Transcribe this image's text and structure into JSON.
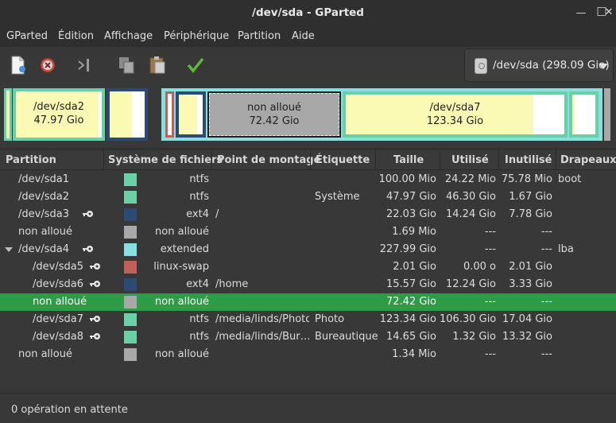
{
  "window": {
    "title": "/dev/sda - GParted"
  },
  "menu": [
    "GParted",
    "Édition",
    "Affichage",
    "Périphérique",
    "Partition",
    "Aide"
  ],
  "toolbar": {
    "buttons": [
      "new-icon",
      "delete-icon",
      "resize-move-icon",
      "copy-icon",
      "paste-icon",
      "apply-icon"
    ],
    "device": "/dev/sda (298.09 Gio)"
  },
  "diskmap": {
    "sda2": {
      "name": "/dev/sda2",
      "size": "47.97 Gio"
    },
    "unalloc": {
      "name": "non alloué",
      "size": "72.42 Gio"
    },
    "sda7": {
      "name": "/dev/sda7",
      "size": "123.34 Gio"
    }
  },
  "columns": [
    "Partition",
    "Système de fichiers",
    "Point de montage",
    "Étiquette",
    "Taille",
    "Utilisé",
    "Inutilisé",
    "Drapeaux"
  ],
  "rows": [
    {
      "partition": "/dev/sda1",
      "fs": "ntfs",
      "mount": "",
      "label": "",
      "size": "100.00 Mio",
      "used": "24.22 Mio",
      "unused": "75.78 Mio",
      "flags": "boot",
      "color": "#6bd0a8",
      "locked": false,
      "indent": 1,
      "expander": false,
      "selected": false
    },
    {
      "partition": "/dev/sda2",
      "fs": "ntfs",
      "mount": "",
      "label": "Système",
      "size": "47.97 Gio",
      "used": "46.30 Gio",
      "unused": "1.67 Gio",
      "flags": "",
      "color": "#6bd0a8",
      "locked": false,
      "indent": 1,
      "expander": false,
      "selected": false
    },
    {
      "partition": "/dev/sda3",
      "fs": "ext4",
      "mount": "/",
      "label": "",
      "size": "22.03 Gio",
      "used": "14.24 Gio",
      "unused": "7.78 Gio",
      "flags": "",
      "color": "#2d4a73",
      "locked": true,
      "indent": 1,
      "expander": false,
      "selected": false
    },
    {
      "partition": "non alloué",
      "fs": "non alloué",
      "mount": "",
      "label": "",
      "size": "1.69 Mio",
      "used": "---",
      "unused": "---",
      "flags": "",
      "color": "#a8a8a8",
      "locked": false,
      "indent": 1,
      "expander": false,
      "selected": false
    },
    {
      "partition": "/dev/sda4",
      "fs": "extended",
      "mount": "",
      "label": "",
      "size": "227.99 Gio",
      "used": "---",
      "unused": "---",
      "flags": "lba",
      "color": "#86e0e0",
      "locked": true,
      "indent": 1,
      "expander": true,
      "selected": false
    },
    {
      "partition": "/dev/sda5",
      "fs": "linux-swap",
      "mount": "",
      "label": "",
      "size": "2.01 Gio",
      "used": "0.00 o",
      "unused": "2.01 Gio",
      "flags": "",
      "color": "#c0605a",
      "locked": true,
      "indent": 2,
      "expander": false,
      "selected": false
    },
    {
      "partition": "/dev/sda6",
      "fs": "ext4",
      "mount": "/home",
      "label": "",
      "size": "15.57 Gio",
      "used": "12.24 Gio",
      "unused": "3.33 Gio",
      "flags": "",
      "color": "#2d4a73",
      "locked": true,
      "indent": 2,
      "expander": false,
      "selected": false
    },
    {
      "partition": "non alloué",
      "fs": "non alloué",
      "mount": "",
      "label": "",
      "size": "72.42 Gio",
      "used": "---",
      "unused": "---",
      "flags": "",
      "color": "#a8a8a8",
      "locked": false,
      "indent": 2,
      "expander": false,
      "selected": true
    },
    {
      "partition": "/dev/sda7",
      "fs": "ntfs",
      "mount": "/media/linds/Photo",
      "label": "Photo",
      "size": "123.34 Gio",
      "used": "106.30 Gio",
      "unused": "17.04 Gio",
      "flags": "",
      "color": "#6bd0a8",
      "locked": true,
      "indent": 2,
      "expander": false,
      "selected": false
    },
    {
      "partition": "/dev/sda8",
      "fs": "ntfs",
      "mount": "/media/linds/Bur…",
      "label": "Bureautique",
      "size": "14.65 Gio",
      "used": "1.32 Gio",
      "unused": "13.32 Gio",
      "flags": "",
      "color": "#6bd0a8",
      "locked": true,
      "indent": 2,
      "expander": false,
      "selected": false
    },
    {
      "partition": "non alloué",
      "fs": "non alloué",
      "mount": "",
      "label": "",
      "size": "1.34 Mio",
      "used": "---",
      "unused": "---",
      "flags": "",
      "color": "#a8a8a8",
      "locked": false,
      "indent": 1,
      "expander": false,
      "selected": false
    }
  ],
  "status": "0 opération en attente"
}
